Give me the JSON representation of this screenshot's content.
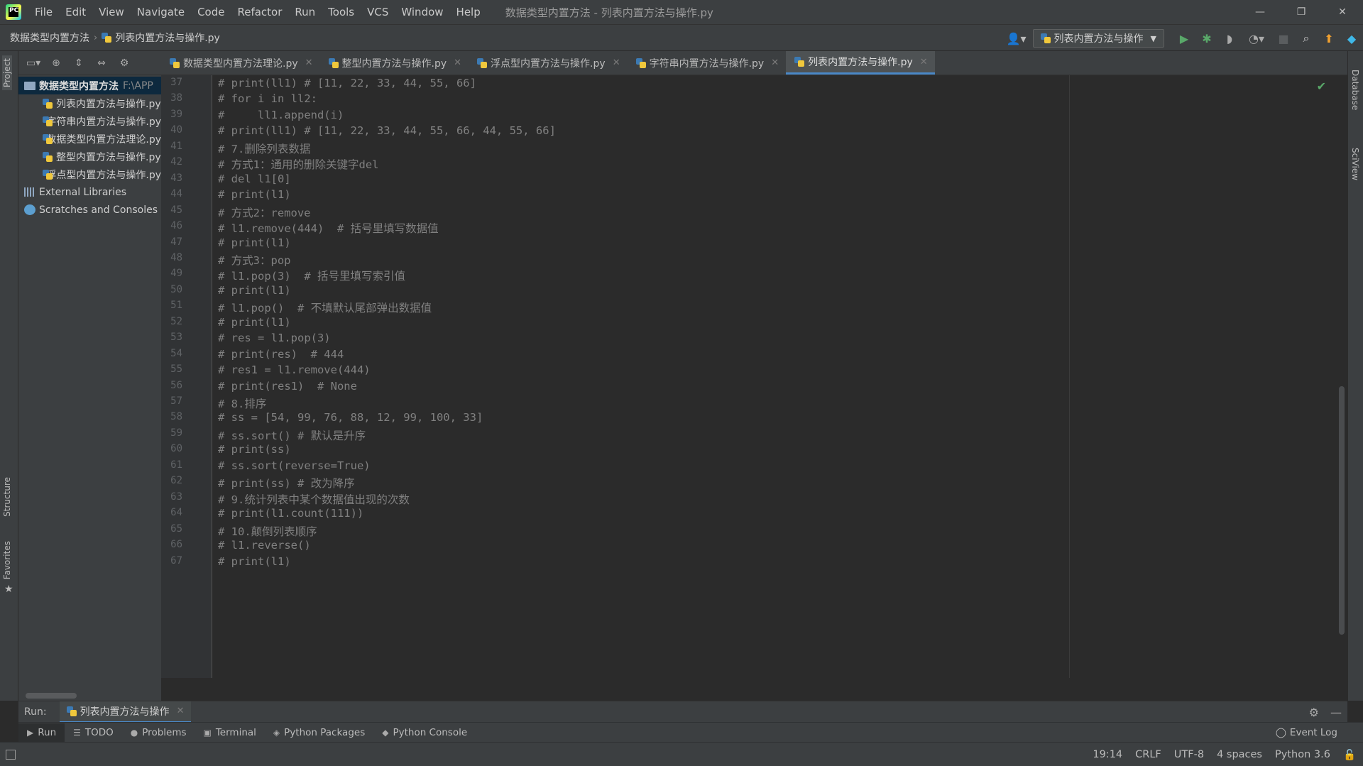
{
  "menubar": {
    "items": [
      "File",
      "Edit",
      "View",
      "Navigate",
      "Code",
      "Refactor",
      "Run",
      "Tools",
      "VCS",
      "Window",
      "Help"
    ],
    "window_title": "数据类型内置方法 - 列表内置方法与操作.py"
  },
  "navbar": {
    "breadcrumb_project": "数据类型内置方法",
    "breadcrumb_file": "列表内置方法与操作.py",
    "run_config": "列表内置方法与操作"
  },
  "side_tabs": {
    "project": "Project",
    "structure": "Structure",
    "favorites": "Favorites",
    "database": "Database",
    "sciview": "SciView"
  },
  "project_tree": {
    "root_name": "数据类型内置方法",
    "root_path": "F:\\APP",
    "files": [
      "列表内置方法与操作.py",
      "字符串内置方法与操作.py",
      "数据类型内置方法理论.py",
      "整型内置方法与操作.py",
      "浮点型内置方法与操作.py"
    ],
    "external_libraries": "External Libraries",
    "scratches": "Scratches and Consoles"
  },
  "editor_tabs": [
    {
      "label": "数据类型内置方法理论.py",
      "active": false
    },
    {
      "label": "整型内置方法与操作.py",
      "active": false
    },
    {
      "label": "浮点型内置方法与操作.py",
      "active": false
    },
    {
      "label": "字符串内置方法与操作.py",
      "active": false
    },
    {
      "label": "列表内置方法与操作.py",
      "active": true
    }
  ],
  "code_lines": [
    {
      "n": "37",
      "text": "# print(ll1) # [11, 22, 33, 44, 55, 66]"
    },
    {
      "n": "38",
      "text": "# for i in ll2:"
    },
    {
      "n": "39",
      "text": "#     ll1.append(i)"
    },
    {
      "n": "40",
      "text": "# print(ll1) # [11, 22, 33, 44, 55, 66, 44, 55, 66]"
    },
    {
      "n": "41",
      "text": "# 7.删除列表数据"
    },
    {
      "n": "42",
      "text": "# 方式1：通用的删除关键字del"
    },
    {
      "n": "43",
      "text": "# del l1[0]"
    },
    {
      "n": "44",
      "text": "# print(l1)"
    },
    {
      "n": "45",
      "text": "# 方式2：remove"
    },
    {
      "n": "46",
      "text": "# l1.remove(444)  # 括号里填写数据值"
    },
    {
      "n": "47",
      "text": "# print(l1)"
    },
    {
      "n": "48",
      "text": "# 方式3：pop"
    },
    {
      "n": "49",
      "text": "# l1.pop(3)  # 括号里填写索引值"
    },
    {
      "n": "50",
      "text": "# print(l1)"
    },
    {
      "n": "51",
      "text": "# l1.pop()  # 不填默认尾部弹出数据值"
    },
    {
      "n": "52",
      "text": "# print(l1)"
    },
    {
      "n": "53",
      "text": "# res = l1.pop(3)"
    },
    {
      "n": "54",
      "text": "# print(res)  # 444"
    },
    {
      "n": "55",
      "text": "# res1 = l1.remove(444)"
    },
    {
      "n": "56",
      "text": "# print(res1)  # None"
    },
    {
      "n": "57",
      "text": "# 8.排序"
    },
    {
      "n": "58",
      "text": "# ss = [54, 99, 76, 88, 12, 99, 100, 33]"
    },
    {
      "n": "59",
      "text": "# ss.sort() # 默认是升序"
    },
    {
      "n": "60",
      "text": "# print(ss)"
    },
    {
      "n": "61",
      "text": "# ss.sort(reverse=True)"
    },
    {
      "n": "62",
      "text": "# print(ss) # 改为降序"
    },
    {
      "n": "63",
      "text": "# 9.统计列表中某个数据值出现的次数"
    },
    {
      "n": "64",
      "text": "# print(l1.count(111))"
    },
    {
      "n": "65",
      "text": "# 10.颠倒列表顺序"
    },
    {
      "n": "66",
      "text": "# l1.reverse()"
    },
    {
      "n": "67",
      "text": "# print(l1)"
    }
  ],
  "run_panel": {
    "label": "Run:",
    "tab": "列表内置方法与操作"
  },
  "tool_buttons": [
    {
      "icon": "▶",
      "label": "Run"
    },
    {
      "icon": "☰",
      "label": "TODO"
    },
    {
      "icon": "●",
      "label": "Problems"
    },
    {
      "icon": "▣",
      "label": "Terminal"
    },
    {
      "icon": "◈",
      "label": "Python Packages"
    },
    {
      "icon": "◆",
      "label": "Python Console"
    }
  ],
  "event_log": "Event Log",
  "status": {
    "position": "19:14",
    "line_sep": "CRLF",
    "encoding": "UTF-8",
    "indent": "4 spaces",
    "interpreter": "Python 3.6"
  },
  "colors": {
    "accent": "#4a88c7",
    "comment": "#808080",
    "run_green": "#59a869",
    "bug_green": "#59a869"
  }
}
